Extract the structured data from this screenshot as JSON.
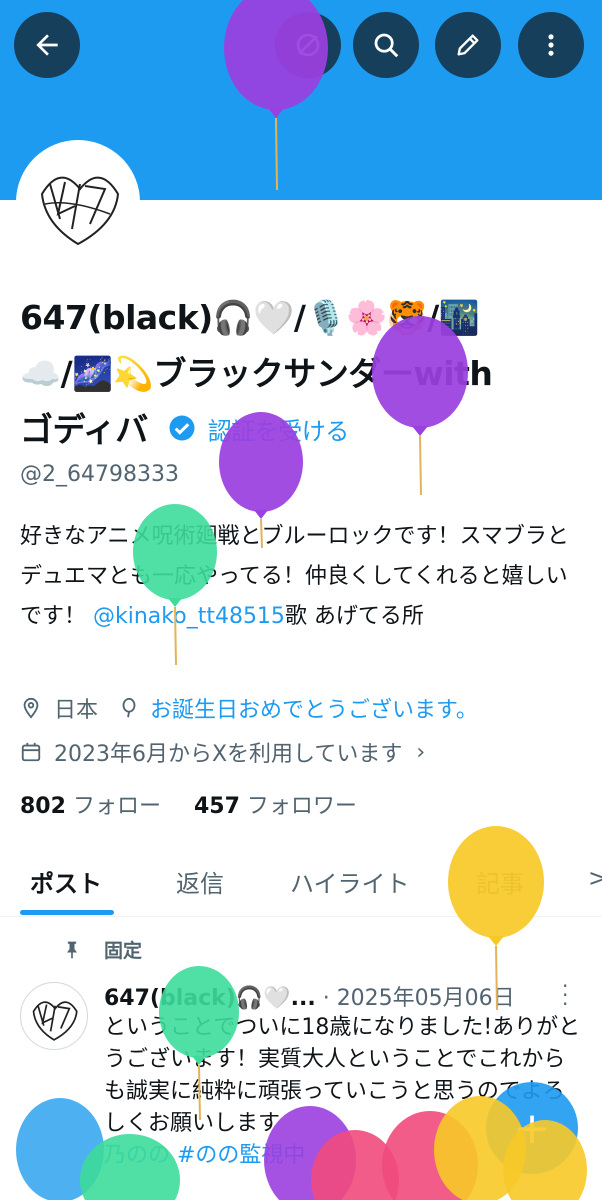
{
  "header": {
    "back_icon": "arrow-left-icon",
    "icons": [
      "grok-icon",
      "search-icon",
      "edit-icon",
      "more-vertical-icon"
    ]
  },
  "profile": {
    "name_line1": "647(black)🎧🤍/🎙️🌸🐯/🌃",
    "name_line2": "☁️/🌌💫ブラックサンダーwith",
    "name_line3": "ゴディバ",
    "verify_label": "認証を受ける",
    "handle": "@2_64798333",
    "bio_part1": "好きなアニメ呪術廻戦とブルーロックです！スマブラとデュエマとも一応やってる！仲良くしてくれると嬉しいです！ ",
    "bio_link": "@kinako_tt48515",
    "bio_part2": "歌 あげてる所",
    "location": "日本",
    "birthday": "お誕生日おめでとうございます。",
    "joined": "2023年6月からXを利用しています",
    "following_count": "802",
    "following_label": "フォロー",
    "followers_count": "457",
    "followers_label": "フォロワー"
  },
  "tabs": [
    "ポスト",
    "返信",
    "ハイライト",
    "記事",
    ">"
  ],
  "pinned_post": {
    "pinned_label": "固定",
    "author": "647(black)🎧🤍...",
    "date": "· 2025年05月06日",
    "text": "ということでついに18歳になりました!ありがとうございます！実質大人ということでこれからも誠実に純粋に頑張っていこうと思うのでよろしくお願いします",
    "tags": "乃のの #のの監視中"
  },
  "fab_label": "+",
  "colors": {
    "accent": "#1d9bf0",
    "header_button": "#163f5c",
    "balloon_purple": "#9b3fe0",
    "balloon_green": "#3ddc9a",
    "balloon_yellow": "#f7c928",
    "balloon_blue": "#3aa8f0",
    "balloon_pink": "#f04a7c"
  }
}
